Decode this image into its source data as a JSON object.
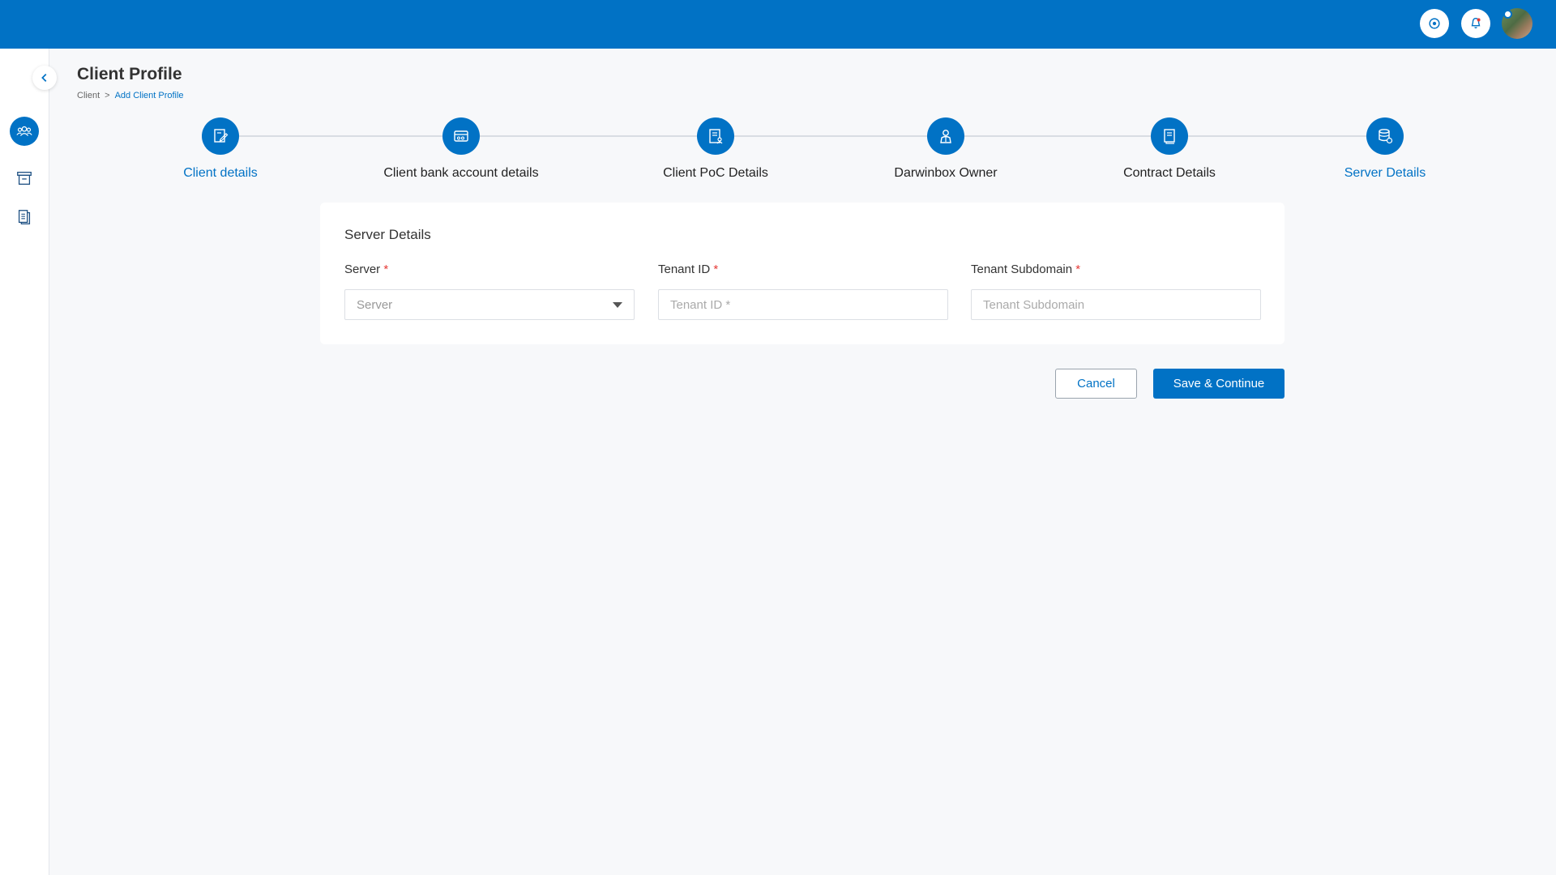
{
  "header": {
    "colors": {
      "brand": "#0172c5",
      "required": "#e53935"
    },
    "buttons": [
      {
        "icon": "settings-icon"
      },
      {
        "icon": "notification-icon"
      }
    ],
    "avatar": {
      "icon": "user-avatar"
    }
  },
  "sidebar": {
    "collapse_icon": "chevron-left-icon",
    "items": [
      {
        "icon": "clients-group-icon",
        "active": true
      },
      {
        "icon": "archive-box-icon",
        "active": false
      },
      {
        "icon": "documents-icon",
        "active": false
      }
    ]
  },
  "page": {
    "title": "Client Profile",
    "breadcrumb": {
      "root": "Client",
      "separator": ">",
      "current": "Add Client Profile"
    }
  },
  "stepper": {
    "steps": [
      {
        "label": "Client details",
        "icon": "edit-document-icon",
        "highlighted": true
      },
      {
        "label": "Client bank account details",
        "icon": "bank-card-icon",
        "highlighted": false
      },
      {
        "label": "Client PoC Details",
        "icon": "contact-document-icon",
        "highlighted": false
      },
      {
        "label": "Darwinbox Owner",
        "icon": "owner-person-icon",
        "highlighted": false
      },
      {
        "label": "Contract Details",
        "icon": "contract-icon",
        "highlighted": false
      },
      {
        "label": "Server Details",
        "icon": "server-database-icon",
        "highlighted": true
      }
    ]
  },
  "form": {
    "title": "Server Details",
    "fields": {
      "server": {
        "label": "Server",
        "required_mark": "*",
        "placeholder": "Server",
        "value": ""
      },
      "tenant_id": {
        "label": "Tenant ID",
        "required_mark": "*",
        "placeholder": "Tenant ID *",
        "value": ""
      },
      "tenant_subdomain": {
        "label": "Tenant Subdomain",
        "required_mark": "*",
        "placeholder": "Tenant Subdomain",
        "value": ""
      }
    }
  },
  "actions": {
    "cancel_label": "Cancel",
    "save_label": "Save & Continue"
  }
}
